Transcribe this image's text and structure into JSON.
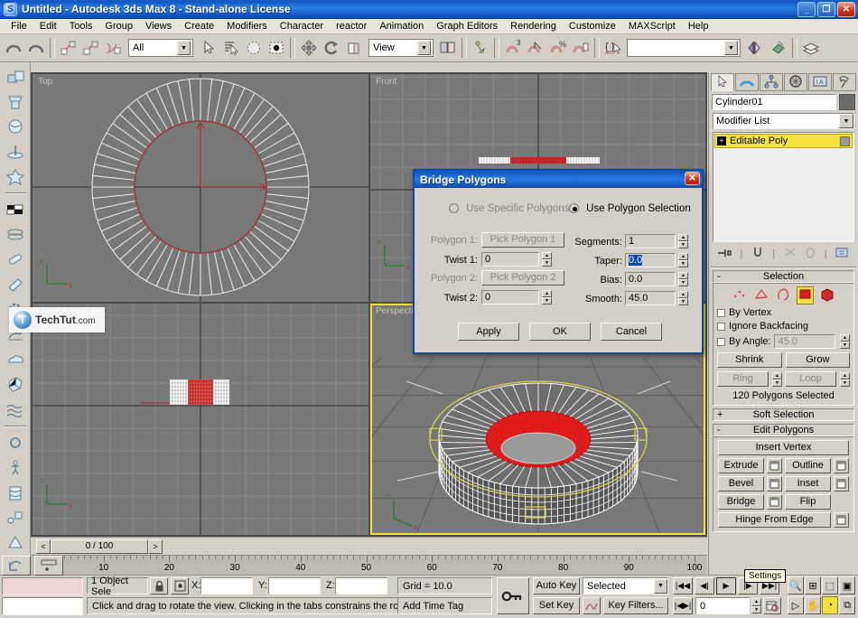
{
  "window": {
    "title": "Untitled - Autodesk 3ds Max 8  - Stand-alone License",
    "logo_glyph": "S",
    "minimize": "_",
    "maximize": "❐",
    "close": "✕"
  },
  "menubar": {
    "items": [
      "File",
      "Edit",
      "Tools",
      "Group",
      "Views",
      "Create",
      "Modifiers",
      "Character",
      "reactor",
      "Animation",
      "Graph Editors",
      "Rendering",
      "Customize",
      "MAXScript",
      "Help"
    ]
  },
  "toolbar": {
    "undo": "undo-arrow-icon",
    "redo": "redo-arrow-icon",
    "select_link": "select-and-link-icon",
    "unlink": "unlink-selection-icon",
    "bind_space": "bind-to-space-warp-icon",
    "selection_filter": "All",
    "select_object": "select-object-icon",
    "select_by_name": "select-by-name-icon",
    "select_region": "selection-region-icon",
    "window_crossing": "window-crossing-icon",
    "select_move": "select-and-move-icon",
    "select_rotate": "select-and-rotate-icon",
    "select_scale": "select-and-scale-icon",
    "ref_coord_system": "View",
    "use_center": "use-pivot-point-center-icon",
    "mirror": "mirror-icon",
    "align": "align-icon",
    "layer_manager": "layer-manager-icon",
    "snap_3d": "snaps-toggle-icon",
    "angle_snap": "angle-snap-toggle-icon",
    "percent_snap": "percent-snap-toggle-icon",
    "spinner_snap": "spinner-snap-toggle-icon",
    "named_sets": "named-selection-sets-icon",
    "named_sets_value": "",
    "dropdown_arrow": "▼"
  },
  "left_toolbar": {
    "items": [
      {
        "name": "box-objects-icon"
      },
      {
        "name": "cloth-icon"
      },
      {
        "name": "sphere-material-icon"
      },
      {
        "name": "pushpin-icon"
      },
      {
        "name": "biped-figure-icon"
      },
      {
        "name": "checker-material-icon"
      },
      {
        "name": "coil-spring-icon"
      },
      {
        "name": "capsule-icon"
      },
      {
        "name": "wedge-icon"
      },
      {
        "name": "gear-icon"
      },
      {
        "name": "bird-icon"
      },
      {
        "name": "cloud-icon"
      },
      {
        "name": "fractured-box-icon"
      },
      {
        "name": "water-waves-icon"
      },
      {
        "name": "torus-knot-icon"
      },
      {
        "name": "ragdoll-icon"
      },
      {
        "name": "cloth-sheet-icon"
      },
      {
        "name": "constraint-icon"
      },
      {
        "name": "rigid-body-icon"
      }
    ]
  },
  "viewports": [
    {
      "id": "vp-top",
      "label": "Top",
      "active": false
    },
    {
      "id": "vp-front",
      "label": "Front",
      "active": false
    },
    {
      "id": "vp-left",
      "label": "",
      "active": false
    },
    {
      "id": "vp-persp",
      "label": "Perspective",
      "active": true
    }
  ],
  "watermark": {
    "glyph": "T",
    "name": "TechTut",
    "suffix": ".com"
  },
  "dialog": {
    "title": "Bridge Polygons",
    "close": "✕",
    "mode_specific": "Use Specific Polygons",
    "mode_selection": "Use Polygon Selection",
    "mode_selected": "Use Polygon Selection",
    "polygon1_label": "Polygon 1:",
    "polygon1_button": "Pick Polygon 1",
    "twist1_label": "Twist 1:",
    "twist1_value": "0",
    "polygon2_label": "Polygon 2:",
    "polygon2_button": "Pick Polygon 2",
    "twist2_label": "Twist 2:",
    "twist2_value": "0",
    "segments_label": "Segments:",
    "segments_value": "1",
    "taper_label": "Taper:",
    "taper_value": "0.0",
    "bias_label": "Bias:",
    "bias_value": "0.0",
    "smooth_label": "Smooth:",
    "smooth_value": "45.0",
    "apply": "Apply",
    "ok": "OK",
    "cancel": "Cancel",
    "spin_up": "▲",
    "spin_down": "▼"
  },
  "command_panel": {
    "tabs": [
      {
        "name": "create-tab",
        "icon": "arrow-cursor-icon",
        "active": true
      },
      {
        "name": "modify-tab",
        "icon": "rainbow-arc-icon",
        "active": false
      },
      {
        "name": "hierarchy-tab",
        "icon": "hierarchy-tree-icon",
        "active": false
      },
      {
        "name": "motion-tab",
        "icon": "wheel-icon",
        "active": false
      },
      {
        "name": "display-tab",
        "icon": "monitor-icon",
        "active": false
      },
      {
        "name": "utilities-tab",
        "icon": "hammer-icon",
        "active": false
      }
    ],
    "object_name": "Cylinder01",
    "modifier_list_label": "Modifier List",
    "modifier_stack": [
      {
        "label": "Editable Poly",
        "expand": "+",
        "selected": true
      }
    ],
    "stack_tools": [
      "pin-stack-icon",
      "show-end-result-icon",
      "make-unique-icon",
      "remove-modifier-icon",
      "configure-sets-icon"
    ],
    "rollouts": {
      "selection": {
        "title": "Selection",
        "sign": "-",
        "sub_object_icons": [
          "vertex-icon",
          "edge-icon",
          "border-icon",
          "polygon-icon",
          "element-icon"
        ],
        "active_sub_object": "polygon-icon",
        "by_vertex": "By Vertex",
        "ignore_backfacing": "Ignore Backfacing",
        "by_angle": "By Angle:",
        "by_angle_value": "45.0",
        "shrink": "Shrink",
        "grow": "Grow",
        "ring": "Ring",
        "loop": "Loop",
        "status": "120 Polygons Selected"
      },
      "soft_selection": {
        "title": "Soft Selection",
        "sign": "+"
      },
      "edit_polygons": {
        "title": "Edit Polygons",
        "sign": "-",
        "insert_vertex": "Insert Vertex",
        "buttons": [
          {
            "label": "Extrude",
            "settings": true
          },
          {
            "label": "Outline",
            "settings": true
          },
          {
            "label": "Bevel",
            "settings": true
          },
          {
            "label": "Inset",
            "settings": true
          },
          {
            "label": "Bridge",
            "settings": true
          },
          {
            "label": "Flip",
            "settings": false
          },
          {
            "label": "Hinge From Edge",
            "settings": true
          }
        ]
      }
    }
  },
  "tooltip": {
    "text": "Settings"
  },
  "time_slider": {
    "prev": "<",
    "value": "0 / 100",
    "next": ">"
  },
  "track_bar": {
    "labels": [
      "10",
      "20",
      "30",
      "40",
      "50",
      "60",
      "70",
      "80",
      "90",
      "100"
    ],
    "start": "0"
  },
  "status_bar": {
    "selection_status": "1 Object Sele",
    "lock_icon": "lock-selection-icon",
    "abs_rel_icon": "absolute-relative-transform-icon",
    "x_label": "X:",
    "x_value": "",
    "y_label": "Y:",
    "y_value": "",
    "z_label": "Z:",
    "z_value": "",
    "grid": "Grid = 10.0",
    "prompt": "Click and drag to rotate the view.  Clicking in the tabs constrains the rotation",
    "add_time_tag": "Add Time Tag",
    "key_mode_icon": "key-mode-toggle-icon"
  },
  "animation_bar": {
    "auto_key": "Auto Key",
    "set_key": "Set Key",
    "key_set": "Selected",
    "key_filters": "Key Filters...",
    "curve_icon": "parameter-curve-icon",
    "dropdown_arrow": "▼",
    "playback": [
      {
        "name": "go-to-start-button",
        "glyph": "|◀◀"
      },
      {
        "name": "previous-frame-button",
        "glyph": "◀|"
      },
      {
        "name": "play-animation-button",
        "glyph": "▶"
      },
      {
        "name": "next-frame-button",
        "glyph": "|▶"
      },
      {
        "name": "go-to-end-button",
        "glyph": "▶▶|"
      }
    ],
    "key_mode_glyph": "|◀▶|",
    "frame_field": "0"
  },
  "viewport_nav": {
    "row1": [
      {
        "name": "zoom-icon",
        "glyph": "🔍"
      },
      {
        "name": "zoom-all-icon",
        "glyph": "⊞"
      },
      {
        "name": "zoom-extents-icon",
        "glyph": "⬚"
      },
      {
        "name": "zoom-extents-all-icon",
        "glyph": "▣"
      }
    ],
    "row2": [
      {
        "name": "field-of-view-icon",
        "glyph": "▷"
      },
      {
        "name": "pan-icon",
        "glyph": "✋"
      },
      {
        "name": "arc-rotate-icon",
        "glyph": "◔"
      },
      {
        "name": "maximize-viewport-toggle-icon",
        "glyph": "⧉"
      }
    ],
    "active": "arc-rotate-icon"
  },
  "colors": {
    "titlebar_blue": "#1b66d3",
    "panel_gray": "#d4d0c8",
    "viewport_gray": "#787878",
    "selection_red": "#e01b1b",
    "active_yellow": "#f3e23b",
    "gizmo_yellow": "#d8cf4a"
  }
}
